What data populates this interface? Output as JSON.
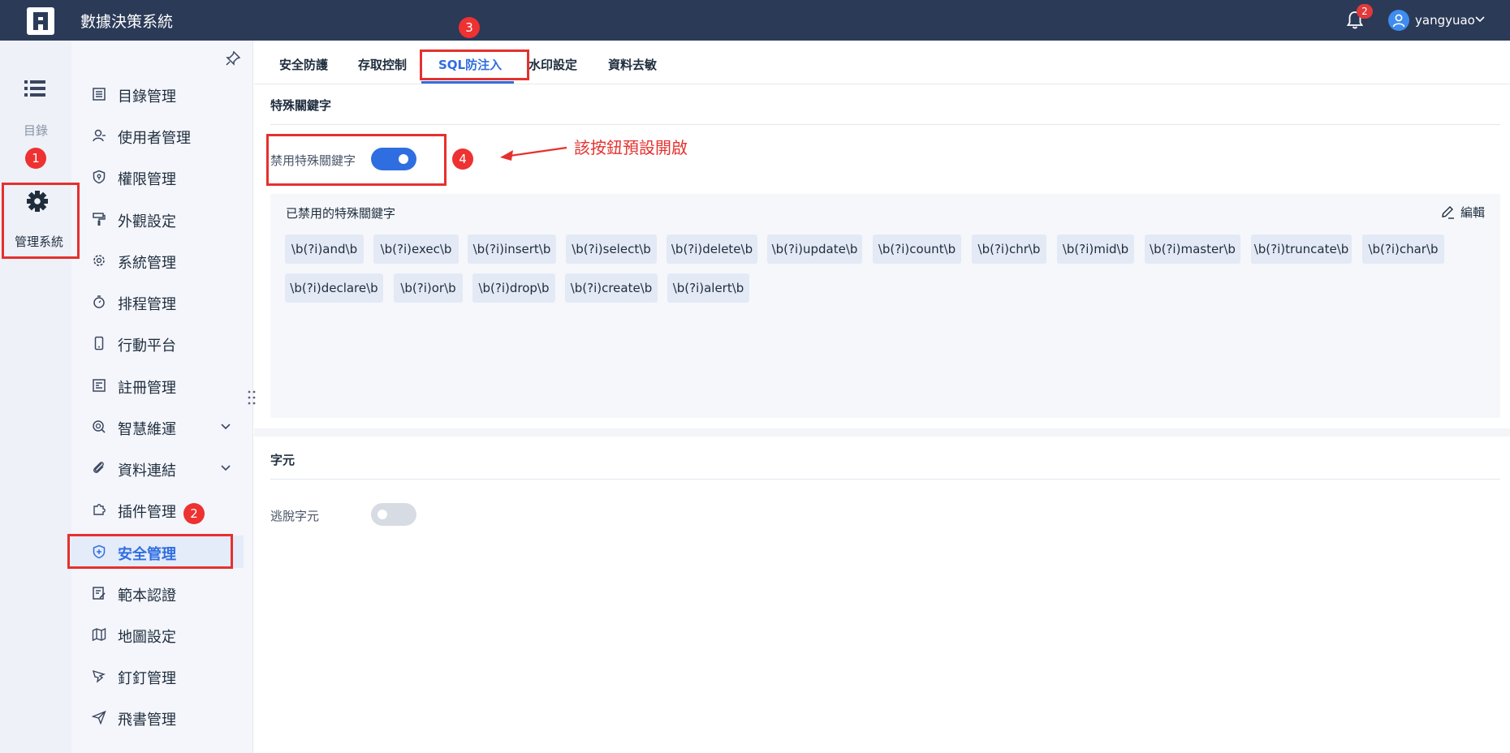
{
  "app": {
    "title": "數據決策系統",
    "notification_count": "2",
    "username": "yangyuao"
  },
  "rail": {
    "catalog_label": "目錄",
    "admin_label": "管理系統"
  },
  "sidebar": {
    "items": [
      {
        "label": "目錄管理",
        "icon": "list-icon"
      },
      {
        "label": "使用者管理",
        "icon": "user-icon"
      },
      {
        "label": "權限管理",
        "icon": "shield-lock-icon"
      },
      {
        "label": "外觀設定",
        "icon": "paint-roller-icon"
      },
      {
        "label": "系統管理",
        "icon": "gear-icon"
      },
      {
        "label": "排程管理",
        "icon": "timer-icon"
      },
      {
        "label": "行動平台",
        "icon": "mobile-icon"
      },
      {
        "label": "註冊管理",
        "icon": "register-icon"
      },
      {
        "label": "智慧維運",
        "icon": "maintenance-icon"
      },
      {
        "label": "資料連結",
        "icon": "link-icon"
      },
      {
        "label": "插件管理",
        "icon": "puzzle-icon"
      },
      {
        "label": "安全管理",
        "icon": "shield-plus-icon"
      },
      {
        "label": "範本認證",
        "icon": "template-cert-icon"
      },
      {
        "label": "地圖設定",
        "icon": "map-icon"
      },
      {
        "label": "釘釘管理",
        "icon": "dingtalk-icon"
      },
      {
        "label": "飛書管理",
        "icon": "send-icon"
      }
    ]
  },
  "tabs": [
    {
      "label": "安全防護"
    },
    {
      "label": "存取控制"
    },
    {
      "label": "SQL防注入"
    },
    {
      "label": "水印設定"
    },
    {
      "label": "資料去敏"
    }
  ],
  "keywords_section": {
    "title": "特殊關鍵字",
    "toggle_label": "禁用特殊關鍵字",
    "toggle_on": true,
    "panel_title": "已禁用的特殊關鍵字",
    "edit_label": "編輯",
    "keywords": [
      "\\b(?i)and\\b",
      "\\b(?i)exec\\b",
      "\\b(?i)insert\\b",
      "\\b(?i)select\\b",
      "\\b(?i)delete\\b",
      "\\b(?i)update\\b",
      "\\b(?i)count\\b",
      "\\b(?i)chr\\b",
      "\\b(?i)mid\\b",
      "\\b(?i)master\\b",
      "\\b(?i)truncate\\b",
      "\\b(?i)char\\b",
      "\\b(?i)declare\\b",
      "\\b(?i)or\\b",
      "\\b(?i)drop\\b",
      "\\b(?i)create\\b",
      "\\b(?i)alert\\b"
    ]
  },
  "chars_section": {
    "title": "字元",
    "toggle_label": "逃脫字元",
    "toggle_on": false
  },
  "annotations": {
    "badges": [
      "1",
      "2",
      "3",
      "4"
    ],
    "note": "該按鈕預設開啟",
    "color": "#e5312e"
  },
  "colors": {
    "header": "#2b3a57",
    "accent": "#2f6ee0",
    "annotation": "#e5312e"
  }
}
